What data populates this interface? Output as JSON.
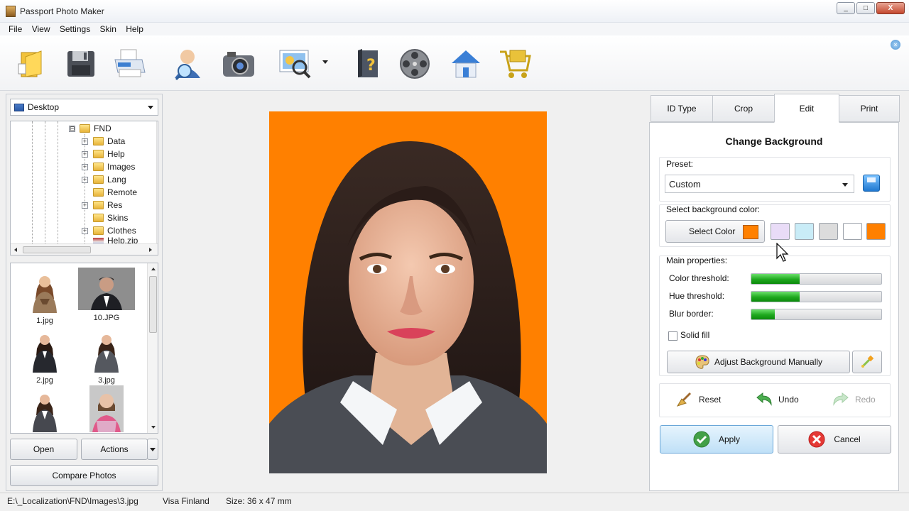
{
  "window": {
    "title": "Passport Photo Maker",
    "controls": [
      "_",
      "□",
      "X"
    ]
  },
  "menu": [
    "File",
    "View",
    "Settings",
    "Skin",
    "Help"
  ],
  "toolbar": {
    "icons": [
      "new-project-icon",
      "save-icon",
      "print-icon",
      "user-search-icon",
      "camera-icon",
      "photo-zoom-icon",
      "help-book-icon",
      "video-tutorial-icon",
      "home-icon",
      "shopping-cart-icon"
    ],
    "close_label": "×"
  },
  "left": {
    "folder": "Desktop",
    "tree": [
      {
        "label": "FND",
        "expanded": true
      },
      {
        "label": "Data"
      },
      {
        "label": "Help"
      },
      {
        "label": "Images"
      },
      {
        "label": "Lang"
      },
      {
        "label": "Remote"
      },
      {
        "label": "Res"
      },
      {
        "label": "Skins"
      },
      {
        "label": "Clothes"
      },
      {
        "label": "Help.zip"
      }
    ],
    "tree_expander_minus": "⊟",
    "tree_expander_plus": "+",
    "thumbnails": [
      "1.jpg",
      "10.JPG",
      "2.jpg",
      "3.jpg"
    ],
    "open_label": "Open",
    "actions_label": "Actions",
    "compare_label": "Compare Photos"
  },
  "tabs": [
    "ID Type",
    "Crop",
    "Edit",
    "Print"
  ],
  "active_tab": "Edit",
  "edit": {
    "title": "Change Background",
    "preset_label": "Preset:",
    "preset_value": "Custom",
    "color_label": "Select background color:",
    "select_color_label": "Select Color",
    "selected_color": "#ff8000",
    "swatches": [
      "#e9dcf7",
      "#c9ecf7",
      "#dcdcdc",
      "#ffffff",
      "#ff8000"
    ],
    "main_props_label": "Main properties:",
    "sliders": [
      {
        "label": "Color threshold:",
        "value": 0.37
      },
      {
        "label": "Hue threshold:",
        "value": 0.37
      },
      {
        "label": "Blur border:",
        "value": 0.18
      }
    ],
    "solid_fill_label": "Solid fill",
    "adjust_label": "Adjust Background Manually",
    "reset_label": "Reset",
    "undo_label": "Undo",
    "redo_label": "Redo",
    "apply_label": "Apply",
    "cancel_label": "Cancel"
  },
  "status": {
    "path": "E:\\_Localization\\FND\\Images\\3.jpg",
    "doc_type": "Visa Finland",
    "size": "Size: 36 x 47 mm"
  },
  "colors": {
    "accent": "#ff8000",
    "slider_fill": "#1ea81e",
    "apply_bg": "#cfe8fa"
  }
}
